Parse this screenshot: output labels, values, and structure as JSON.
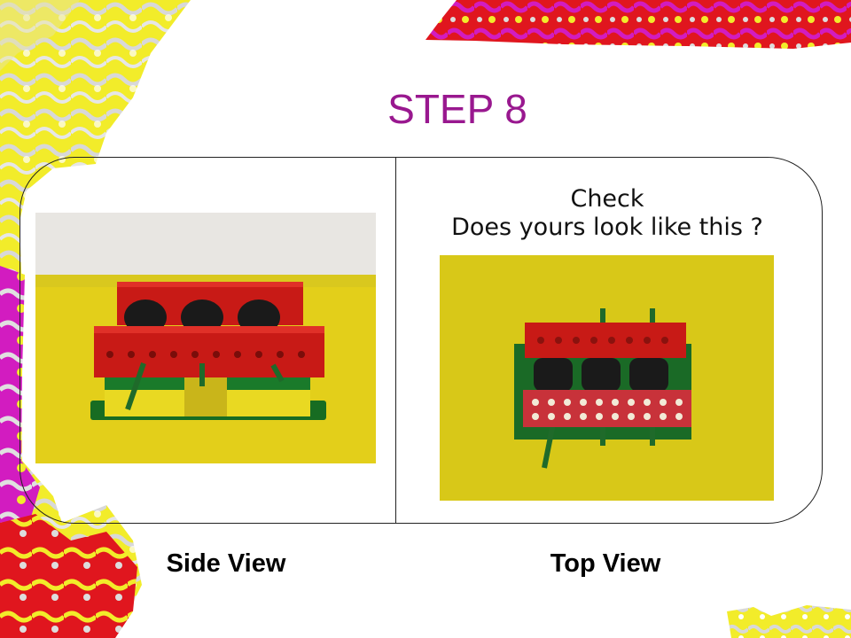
{
  "slide": {
    "title": "STEP 8",
    "check_line1": "Check",
    "check_line2": "Does yours look like this ?",
    "side_caption": "Side View",
    "top_caption": "Top View"
  },
  "colors": {
    "title": "#99188f",
    "deco_yellow": "#f2ec2a",
    "deco_red": "#e0161e",
    "deco_magenta": "#d21cc0",
    "brick_red": "#c81a16",
    "brick_green": "#1a7a2a",
    "photo_background": "#e3cf1a"
  },
  "images": {
    "side_view": "lego-gear-assembly-side-photo",
    "top_view": "lego-gear-assembly-top-photo"
  }
}
